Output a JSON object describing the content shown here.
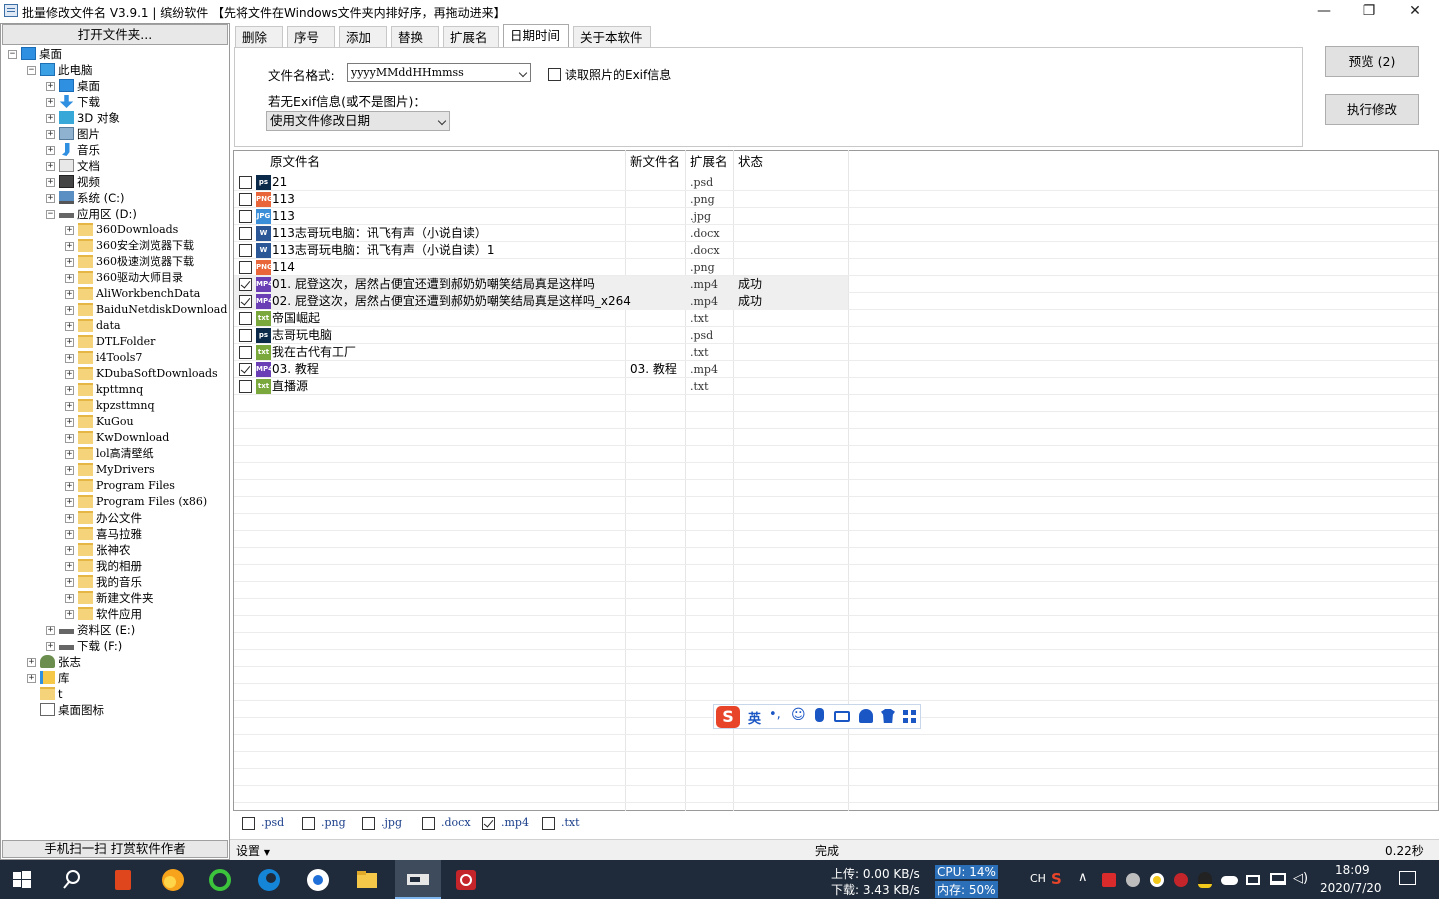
{
  "window": {
    "title": "批量修改文件名 V3.9.1 | 缤纷软件  【先将文件在Windows文件夹内排好序，再拖动进来】",
    "minimize": "—",
    "maximize": "❐",
    "close": "✕"
  },
  "left": {
    "open_button": "打开文件夹...",
    "qr_button": "手机扫一扫 打赏软件作者",
    "tree": [
      {
        "label": "桌面",
        "level": 0,
        "exp": "-",
        "icon": "desktop-icon"
      },
      {
        "label": "此电脑",
        "level": 1,
        "exp": "-",
        "icon": "pc-icon"
      },
      {
        "label": "桌面",
        "level": 2,
        "exp": "+",
        "icon": "desktop-icon"
      },
      {
        "label": "下载",
        "level": 2,
        "exp": "+",
        "icon": "download-icon"
      },
      {
        "label": "3D 对象",
        "level": 2,
        "exp": "+",
        "icon": "3d-icon"
      },
      {
        "label": "图片",
        "level": 2,
        "exp": "+",
        "icon": "pictures-icon"
      },
      {
        "label": "音乐",
        "level": 2,
        "exp": "+",
        "icon": "music-icon"
      },
      {
        "label": "文档",
        "level": 2,
        "exp": "+",
        "icon": "documents-icon"
      },
      {
        "label": "视频",
        "level": 2,
        "exp": "+",
        "icon": "video-icon"
      },
      {
        "label": "系统 (C:)",
        "level": 2,
        "exp": "+",
        "icon": "system-drive-icon"
      },
      {
        "label": "应用区 (D:)",
        "level": 2,
        "exp": "-",
        "icon": "drive-icon"
      },
      {
        "label": "360Downloads",
        "level": 3,
        "exp": "+",
        "icon": "folder-icon"
      },
      {
        "label": "360安全浏览器下载",
        "level": 3,
        "exp": "+",
        "icon": "folder-icon"
      },
      {
        "label": "360极速浏览器下载",
        "level": 3,
        "exp": "+",
        "icon": "folder-icon"
      },
      {
        "label": "360驱动大师目录",
        "level": 3,
        "exp": "+",
        "icon": "folder-icon"
      },
      {
        "label": "AliWorkbenchData",
        "level": 3,
        "exp": "+",
        "icon": "folder-icon"
      },
      {
        "label": "BaiduNetdiskDownload",
        "level": 3,
        "exp": "+",
        "icon": "folder-icon"
      },
      {
        "label": "data",
        "level": 3,
        "exp": "+",
        "icon": "folder-icon"
      },
      {
        "label": "DTLFolder",
        "level": 3,
        "exp": "+",
        "icon": "folder-icon"
      },
      {
        "label": "i4Tools7",
        "level": 3,
        "exp": "+",
        "icon": "folder-icon"
      },
      {
        "label": "KDubaSoftDownloads",
        "level": 3,
        "exp": "+",
        "icon": "folder-icon"
      },
      {
        "label": "kpttmnq",
        "level": 3,
        "exp": "+",
        "icon": "folder-icon"
      },
      {
        "label": "kpzsttmnq",
        "level": 3,
        "exp": "+",
        "icon": "folder-icon"
      },
      {
        "label": "KuGou",
        "level": 3,
        "exp": "+",
        "icon": "folder-icon"
      },
      {
        "label": "KwDownload",
        "level": 3,
        "exp": "+",
        "icon": "folder-icon"
      },
      {
        "label": "lol高清壁纸",
        "level": 3,
        "exp": "+",
        "icon": "folder-icon"
      },
      {
        "label": "MyDrivers",
        "level": 3,
        "exp": "+",
        "icon": "folder-icon"
      },
      {
        "label": "Program Files",
        "level": 3,
        "exp": "+",
        "icon": "folder-icon"
      },
      {
        "label": "Program Files (x86)",
        "level": 3,
        "exp": "+",
        "icon": "folder-icon"
      },
      {
        "label": "办公文件",
        "level": 3,
        "exp": "+",
        "icon": "folder-icon"
      },
      {
        "label": "喜马拉雅",
        "level": 3,
        "exp": "+",
        "icon": "folder-icon"
      },
      {
        "label": "张神农",
        "level": 3,
        "exp": "+",
        "icon": "folder-icon"
      },
      {
        "label": "我的相册",
        "level": 3,
        "exp": "+",
        "icon": "folder-icon"
      },
      {
        "label": "我的音乐",
        "level": 3,
        "exp": "+",
        "icon": "folder-icon"
      },
      {
        "label": "新建文件夹",
        "level": 3,
        "exp": "+",
        "icon": "folder-icon"
      },
      {
        "label": "软件应用",
        "level": 3,
        "exp": "+",
        "icon": "folder-icon"
      },
      {
        "label": "资料区 (E:)",
        "level": 2,
        "exp": "+",
        "icon": "drive-icon"
      },
      {
        "label": "下载 (F:)",
        "level": 2,
        "exp": "+",
        "icon": "drive-icon"
      },
      {
        "label": "张志",
        "level": 1,
        "exp": "+",
        "icon": "user-icon"
      },
      {
        "label": "库",
        "level": 1,
        "exp": "+",
        "icon": "library-icon"
      },
      {
        "label": "t",
        "level": 1,
        "exp": "",
        "icon": "folder-icon"
      },
      {
        "label": "桌面图标",
        "level": 1,
        "exp": "",
        "icon": "shortcut-icon"
      }
    ]
  },
  "tabs": [
    "删除",
    "序号",
    "添加",
    "替换",
    "扩展名",
    "日期时间",
    "关于本软件"
  ],
  "active_tab": 5,
  "datetime_tab": {
    "format_label": "文件名格式:",
    "format_value": "yyyyMMddHHmmss",
    "exif_checkbox_label": "读取照片的Exif信息",
    "exif_checked": false,
    "noexif_label": "若无Exif信息(或不是图片)：",
    "noexif_value": "使用文件修改日期"
  },
  "buttons": {
    "preview": "预览 (2)",
    "execute": "执行修改"
  },
  "columns": {
    "original": "原文件名",
    "new": "新文件名",
    "ext": "扩展名",
    "status": "状态"
  },
  "files": [
    {
      "name": "21",
      "new": "",
      "ext": ".psd",
      "status": "",
      "checked": false,
      "icon": "ps",
      "color": "#0b2a4a"
    },
    {
      "name": "113",
      "new": "",
      "ext": ".png",
      "status": "",
      "checked": false,
      "icon": "PNG",
      "color": "#e8663a"
    },
    {
      "name": "113",
      "new": "",
      "ext": ".jpg",
      "status": "",
      "checked": false,
      "icon": "JPG",
      "color": "#3b8fd8"
    },
    {
      "name": "113志哥玩电脑：讯飞有声（小说自读）",
      "new": "",
      "ext": ".docx",
      "status": "",
      "checked": false,
      "icon": "W",
      "color": "#2b5797"
    },
    {
      "name": "113志哥玩电脑：讯飞有声（小说自读）1",
      "new": "",
      "ext": ".docx",
      "status": "",
      "checked": false,
      "icon": "W",
      "color": "#2b5797"
    },
    {
      "name": "114",
      "new": "",
      "ext": ".png",
      "status": "",
      "checked": false,
      "icon": "PNG",
      "color": "#e8663a"
    },
    {
      "name": "01. 屁登这次，居然占便宜还遭到郝奶奶嘲笑结局真是这样吗",
      "new": "",
      "ext": ".mp4",
      "status": "成功",
      "checked": true,
      "icon": "MP4",
      "color": "#6a3fb5"
    },
    {
      "name": "02. 屁登这次，居然占便宜还遭到郝奶奶嘲笑结局真是这样吗_x264",
      "new": "",
      "ext": ".mp4",
      "status": "成功",
      "checked": true,
      "icon": "MP4",
      "color": "#6a3fb5"
    },
    {
      "name": "帝国崛起",
      "new": "",
      "ext": ".txt",
      "status": "",
      "checked": false,
      "icon": "txt",
      "color": "#7aa83c"
    },
    {
      "name": "志哥玩电脑",
      "new": "",
      "ext": ".psd",
      "status": "",
      "checked": false,
      "icon": "ps",
      "color": "#0b2a4a"
    },
    {
      "name": "我在古代有工厂",
      "new": "",
      "ext": ".txt",
      "status": "",
      "checked": false,
      "icon": "txt",
      "color": "#7aa83c"
    },
    {
      "name": "03. 教程",
      "new": "03. 教程",
      "ext": ".mp4",
      "status": "",
      "checked": true,
      "icon": "MP4",
      "color": "#6a3fb5"
    },
    {
      "name": "直播源",
      "new": "",
      "ext": ".txt",
      "status": "",
      "checked": false,
      "icon": "txt",
      "color": "#7aa83c"
    }
  ],
  "filters": [
    {
      "label": ".psd",
      "checked": false
    },
    {
      "label": ".png",
      "checked": false
    },
    {
      "label": ".jpg",
      "checked": false
    },
    {
      "label": ".docx",
      "checked": false
    },
    {
      "label": ".mp4",
      "checked": true
    },
    {
      "label": ".txt",
      "checked": false
    }
  ],
  "status": {
    "settings": "设置",
    "message": "完成",
    "time": "0.22秒"
  },
  "ime": {
    "mode": "英"
  },
  "taskbar": {
    "upload": "上传: 0.00 KB/s",
    "download": "下载: 3.43 KB/s",
    "cpu": "CPU: 14%",
    "mem": "内存: 50%",
    "lang": "CH",
    "time": "18:09",
    "date": "2020/7/20"
  }
}
